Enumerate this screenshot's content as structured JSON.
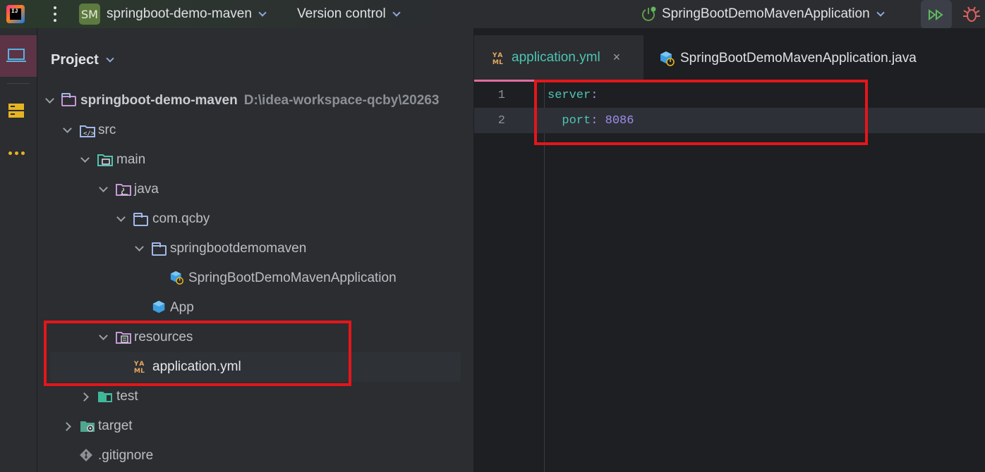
{
  "topbar": {
    "app_logo": "intellij-logo",
    "logo_text": "IJ",
    "project_badge": "SM",
    "project_name": "springboot-demo-maven",
    "vcs_label": "Version control",
    "run_config": "SpringBootDemoMavenApplication"
  },
  "toolstrip": {
    "items": [
      "project-view-icon",
      "structure-icon",
      "more-icon"
    ]
  },
  "project_panel": {
    "title": "Project",
    "tree": [
      {
        "label": "springboot-demo-maven",
        "path": "D:\\idea-workspace-qcby\\20263",
        "icon": "module-folder-icon"
      },
      {
        "label": "src",
        "icon": "source-folder-icon"
      },
      {
        "label": "main",
        "icon": "main-folder-icon"
      },
      {
        "label": "java",
        "icon": "java-folder-icon"
      },
      {
        "label": "com.qcby",
        "icon": "package-icon"
      },
      {
        "label": "springbootdemomaven",
        "icon": "package-icon"
      },
      {
        "label": "SpringBootDemoMavenApplication",
        "icon": "spring-class-icon"
      },
      {
        "label": "App",
        "icon": "class-icon"
      },
      {
        "label": "resources",
        "icon": "resources-folder-icon"
      },
      {
        "label": "application.yml",
        "icon": "yaml-file-icon"
      },
      {
        "label": "test",
        "icon": "test-folder-icon"
      },
      {
        "label": "target",
        "icon": "excluded-folder-icon"
      },
      {
        "label": ".gitignore",
        "icon": "git-file-icon"
      }
    ]
  },
  "editor": {
    "tabs": [
      {
        "label": "application.yml",
        "active": true,
        "close": "×"
      },
      {
        "label": "SpringBootDemoMavenApplication.java",
        "active": false
      }
    ],
    "lines": [
      {
        "num": "1",
        "key": "server",
        "sep": ":"
      },
      {
        "num": "2",
        "indent": "  ",
        "key": "port",
        "sep": ": ",
        "value": "8086"
      }
    ]
  },
  "colors": {
    "highlight_box": "#e3161b",
    "yaml_key": "#4ec4b4",
    "yaml_number": "#9e8ded",
    "active_tab_underline": "#e06c9f"
  }
}
